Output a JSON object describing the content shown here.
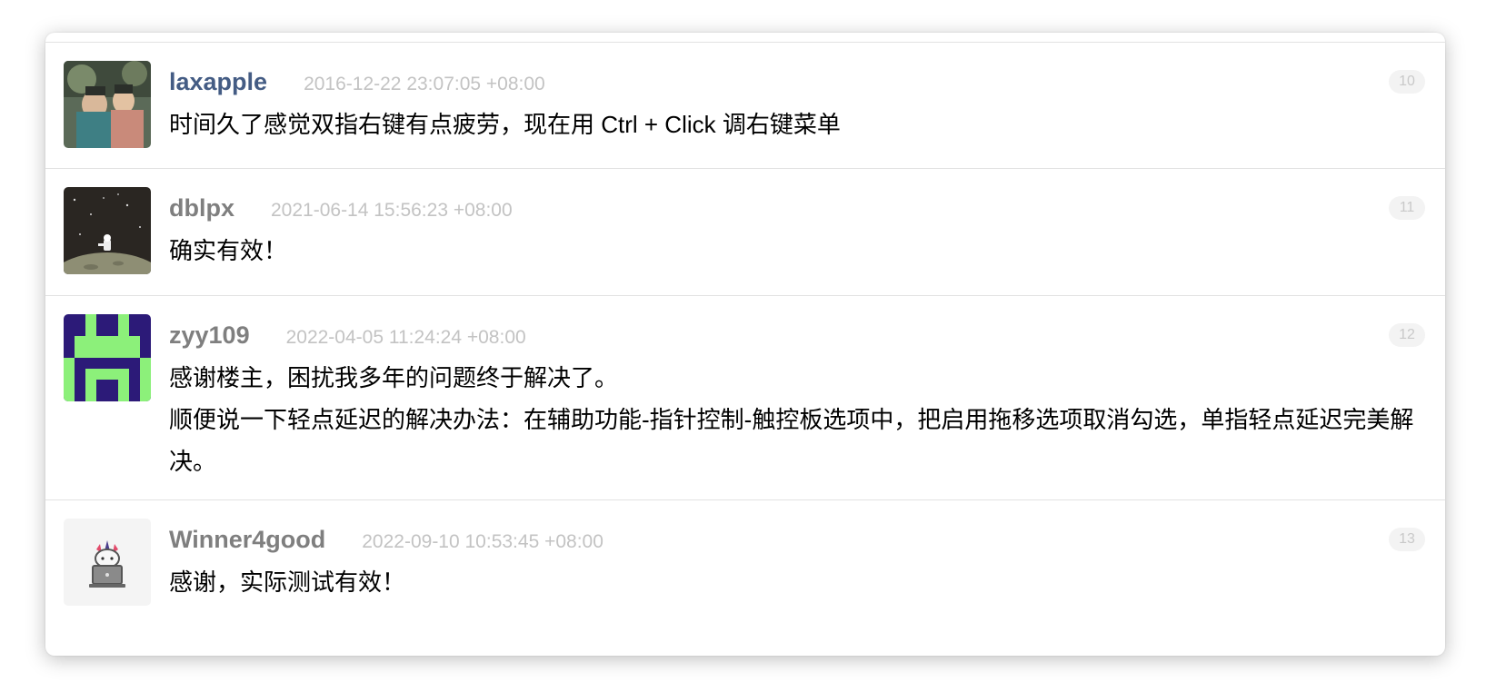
{
  "replies": [
    {
      "username": "laxapple",
      "time": "2016-12-22 23:07:05 +08:00",
      "floor": "10",
      "content": [
        "时间久了感觉双指右键有点疲劳，现在用 Ctrl + Click 调右键菜单"
      ]
    },
    {
      "username": "dblpx",
      "time": "2021-06-14 15:56:23 +08:00",
      "floor": "11",
      "content": [
        "确实有效！"
      ]
    },
    {
      "username": "zyy109",
      "time": "2022-04-05 11:24:24 +08:00",
      "floor": "12",
      "content": [
        "感谢楼主，困扰我多年的问题终于解决了。",
        "顺便说一下轻点延迟的解决办法：在辅助功能-指针控制-触控板选项中，把启用拖移选项取消勾选，单指轻点延迟完美解决。"
      ]
    },
    {
      "username": "Winner4good",
      "time": "2022-09-10 10:53:45 +08:00",
      "floor": "13",
      "content": [
        "感谢，实际测试有效！"
      ]
    }
  ],
  "colors": {
    "member_username": "#445c84",
    "username": "#7f7f7f",
    "timestamp": "#c3c3c3",
    "floor_badge_bg": "#f3f3f3"
  }
}
